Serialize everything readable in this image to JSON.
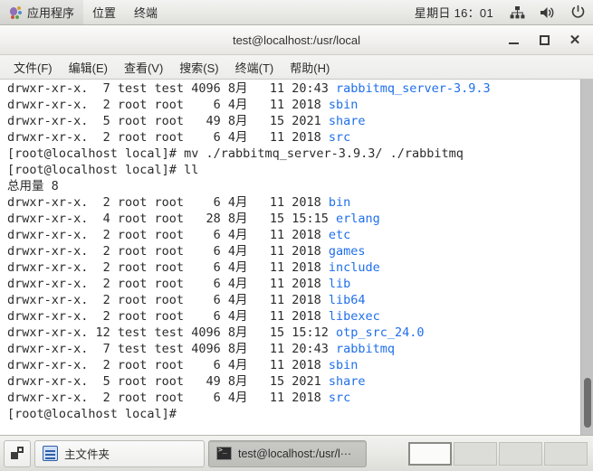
{
  "top_panel": {
    "logo_icon": "gnome-foot-icon",
    "menus": [
      {
        "label": "应用程序",
        "name": "applications"
      },
      {
        "label": "位置",
        "name": "places"
      },
      {
        "label": "终端",
        "name": "terminal"
      }
    ],
    "clock": "星期日 16：01",
    "tray": [
      {
        "icon": "network-icon",
        "name": "network-tray-icon"
      },
      {
        "icon": "volume-icon",
        "name": "volume-tray-icon"
      },
      {
        "icon": "power-icon",
        "name": "power-tray-icon"
      }
    ]
  },
  "window": {
    "title": "test@localhost:/usr/local",
    "controls": {
      "minimize": "−",
      "maximize": "□",
      "close": "✕"
    },
    "menu_bar": [
      {
        "label": "文件(F)",
        "name": "file"
      },
      {
        "label": "编辑(E)",
        "name": "edit"
      },
      {
        "label": "查看(V)",
        "name": "view"
      },
      {
        "label": "搜索(S)",
        "name": "search"
      },
      {
        "label": "终端(T)",
        "name": "terminal"
      },
      {
        "label": "帮助(H)",
        "name": "help"
      }
    ]
  },
  "terminal": {
    "foreground": "#2b2b2b",
    "background": "#ffffff",
    "dir_color": "#1f6feb",
    "lines": [
      {
        "plain": "drwxr-xr-x.  7 test test 4096 8月   11 20:43 ",
        "dir": "rabbitmq_server-3.9.3"
      },
      {
        "plain": "drwxr-xr-x.  2 root root    6 4月   11 2018 ",
        "dir": "sbin"
      },
      {
        "plain": "drwxr-xr-x.  5 root root   49 8月   15 2021 ",
        "dir": "share"
      },
      {
        "plain": "drwxr-xr-x.  2 root root    6 4月   11 2018 ",
        "dir": "src"
      },
      {
        "plain": "[root@localhost local]# mv ./rabbitmq_server-3.9.3/ ./rabbitmq",
        "dir": ""
      },
      {
        "plain": "[root@localhost local]# ll",
        "dir": ""
      },
      {
        "plain": "总用量 8",
        "dir": ""
      },
      {
        "plain": "drwxr-xr-x.  2 root root    6 4月   11 2018 ",
        "dir": "bin"
      },
      {
        "plain": "drwxr-xr-x.  4 root root   28 8月   15 15:15 ",
        "dir": "erlang"
      },
      {
        "plain": "drwxr-xr-x.  2 root root    6 4月   11 2018 ",
        "dir": "etc"
      },
      {
        "plain": "drwxr-xr-x.  2 root root    6 4月   11 2018 ",
        "dir": "games"
      },
      {
        "plain": "drwxr-xr-x.  2 root root    6 4月   11 2018 ",
        "dir": "include"
      },
      {
        "plain": "drwxr-xr-x.  2 root root    6 4月   11 2018 ",
        "dir": "lib"
      },
      {
        "plain": "drwxr-xr-x.  2 root root    6 4月   11 2018 ",
        "dir": "lib64"
      },
      {
        "plain": "drwxr-xr-x.  2 root root    6 4月   11 2018 ",
        "dir": "libexec"
      },
      {
        "plain": "drwxr-xr-x. 12 test test 4096 8月   15 15:12 ",
        "dir": "otp_src_24.0"
      },
      {
        "plain": "drwxr-xr-x.  7 test test 4096 8月   11 20:43 ",
        "dir": "rabbitmq"
      },
      {
        "plain": "drwxr-xr-x.  2 root root    6 4月   11 2018 ",
        "dir": "sbin"
      },
      {
        "plain": "drwxr-xr-x.  5 root root   49 8月   15 2021 ",
        "dir": "share"
      },
      {
        "plain": "drwxr-xr-x.  2 root root    6 4月   11 2018 ",
        "dir": "src"
      },
      {
        "plain": "[root@localhost local]# ",
        "dir": ""
      }
    ],
    "scrollbar": {
      "thumb_top_pct": 84,
      "thumb_height_pct": 14
    }
  },
  "bottom_panel": {
    "show_desktop_icon": "show-desktop-icon",
    "tasks": [
      {
        "label": "主文件夹",
        "icon": "file-cabinet-icon",
        "active": false
      },
      {
        "label": "test@localhost:/usr/l···",
        "icon": "terminal-icon",
        "active": true
      }
    ],
    "workspaces": [
      {
        "name": "workspace-1",
        "active": true
      },
      {
        "name": "workspace-2",
        "active": false
      },
      {
        "name": "workspace-3",
        "active": false
      },
      {
        "name": "workspace-4",
        "active": false
      }
    ]
  }
}
